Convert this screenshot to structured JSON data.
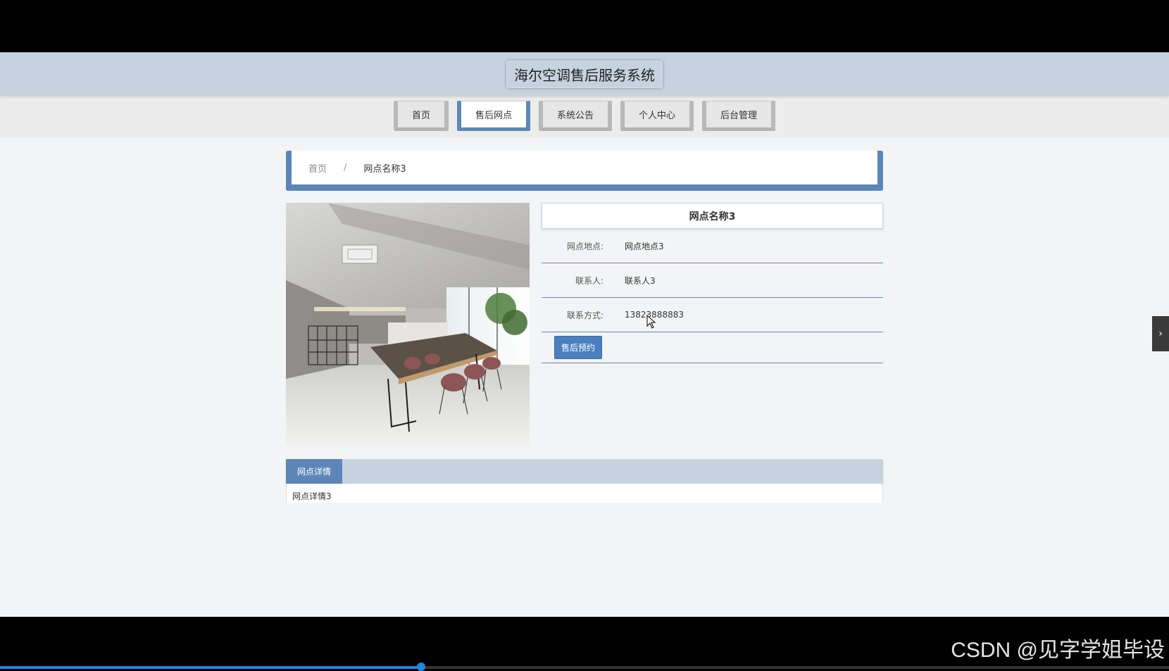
{
  "header": {
    "title": "海尔空调售后服务系统"
  },
  "nav": [
    {
      "label": "首页",
      "active": false
    },
    {
      "label": "售后网点",
      "active": true
    },
    {
      "label": "系统公告",
      "active": false
    },
    {
      "label": "个人中心",
      "active": false
    },
    {
      "label": "后台管理",
      "active": false
    }
  ],
  "breadcrumb": {
    "home": "首页",
    "separator": "/",
    "current": "网点名称3"
  },
  "outlet": {
    "name": "网点名称3",
    "fields": [
      {
        "label": "网点地点:",
        "value": "网点地点3"
      },
      {
        "label": "联系人:",
        "value": "联系人3"
      },
      {
        "label": "联系方式:",
        "value": "13823888883"
      }
    ],
    "book_button": "售后预约"
  },
  "detail": {
    "tab": "网点详情",
    "content": "网点详情3"
  },
  "side_arrow": "›",
  "watermark": "CSDN @见字学姐毕设",
  "video": {
    "progress": 0.36
  },
  "colors": {
    "accent": "#5d86b8",
    "header_bg": "#c6d3df",
    "button": "#4a7fc0"
  },
  "icons": {
    "side_arrow": "chevron-right-icon",
    "cursor": "mouse-pointer-icon"
  }
}
